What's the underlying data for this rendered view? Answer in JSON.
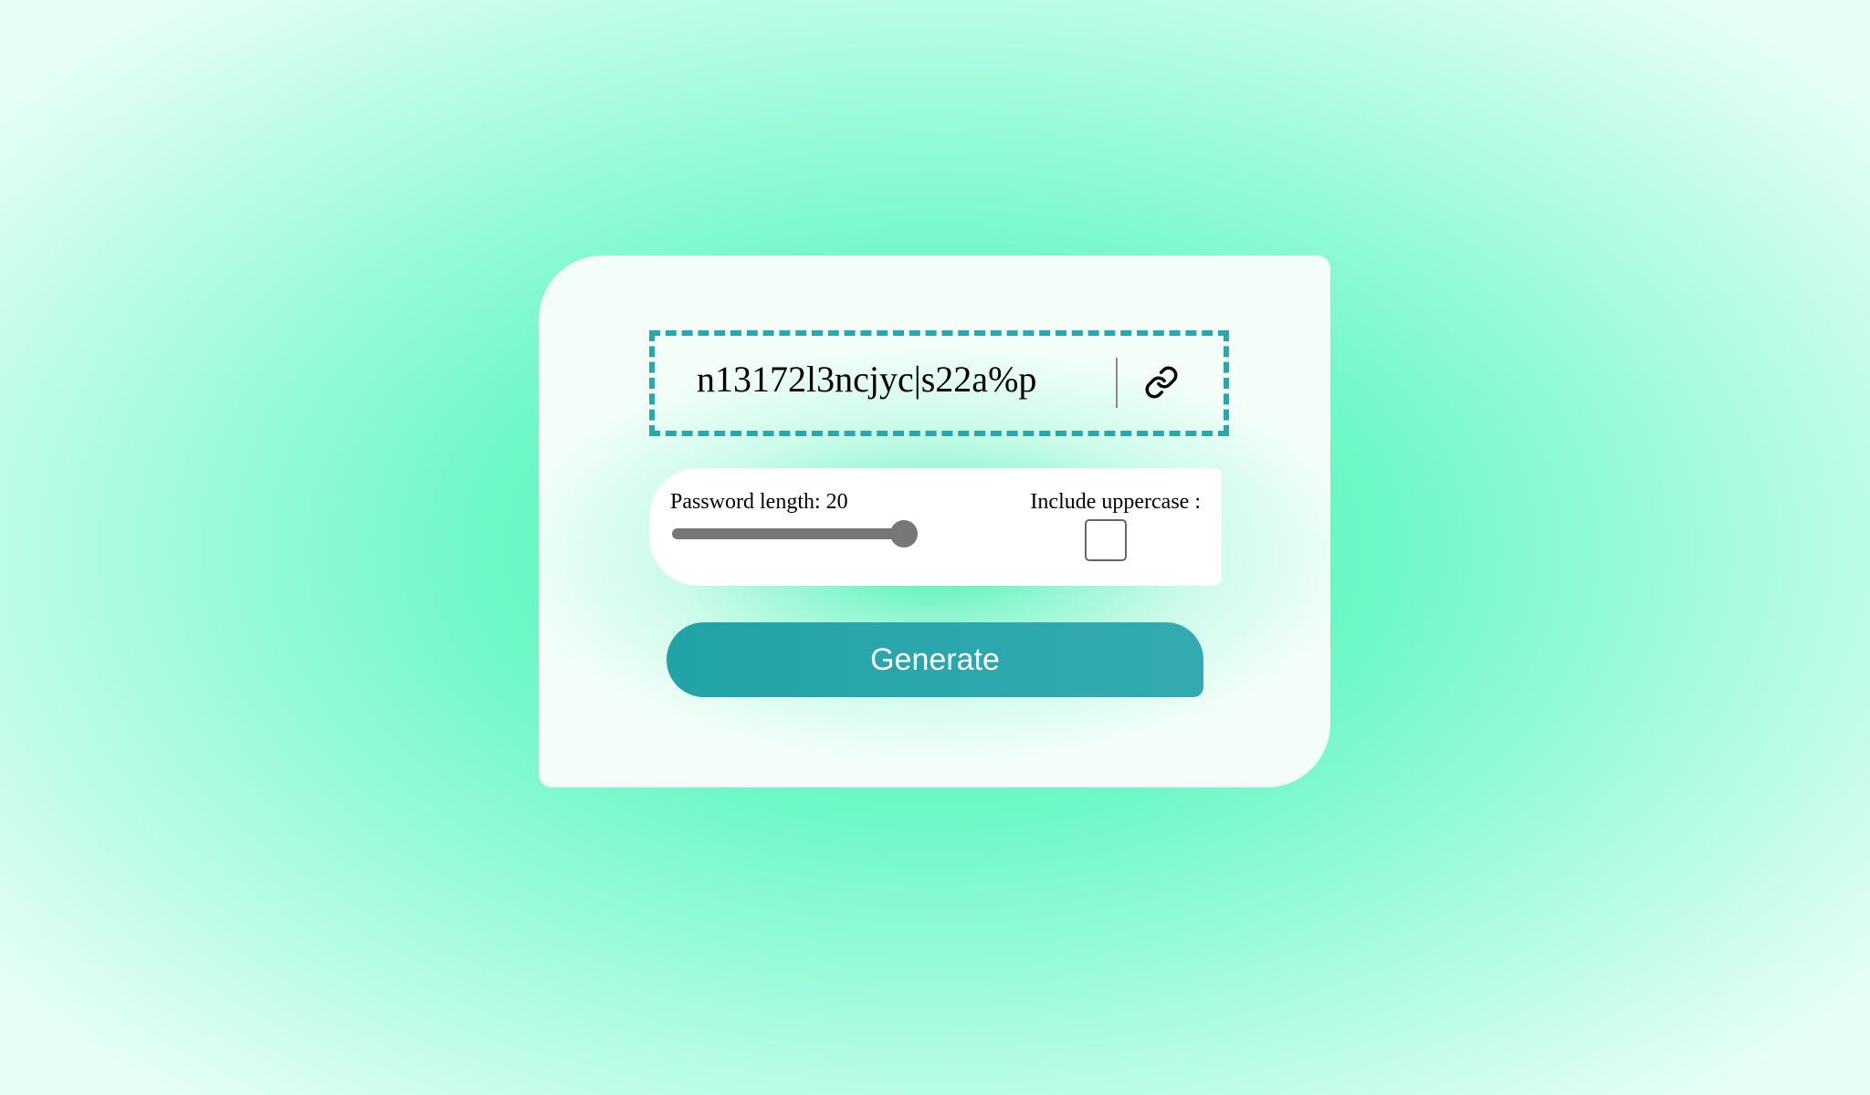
{
  "password": {
    "value": "n13172l3ncjyc|s22a%p",
    "copy_icon": "link-icon"
  },
  "options": {
    "length_label": "Password length: 20",
    "length_value": 20,
    "length_fill_percent": 100,
    "uppercase_label": "Include uppercase :",
    "uppercase_checked": false
  },
  "actions": {
    "generate_label": "Generate"
  },
  "colors": {
    "accent": "#2aa6ad",
    "button_text": "#ffffff",
    "background_mint": "#40f5b4",
    "slider": "#777777"
  }
}
